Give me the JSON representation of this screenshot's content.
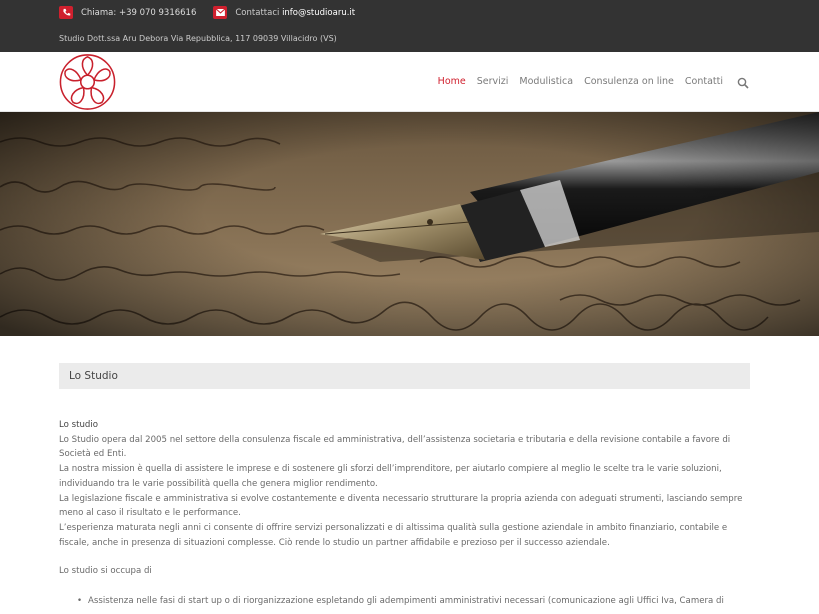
{
  "topbar": {
    "phone_label": "Chiama: +39 070 9316616",
    "email_prefix": "Contattaci",
    "email_value": "info@studioaru.it",
    "address": "Studio Dott.ssa Aru Debora Via Repubblica, 117 09039 Villacidro (VS)",
    "phone_icon": "phone-icon",
    "email_icon": "envelope-icon",
    "icon_bg_color": "#d0202e"
  },
  "nav": {
    "items": [
      {
        "label": "Home",
        "active": true
      },
      {
        "label": "Servizi",
        "active": false
      },
      {
        "label": "Modulistica",
        "active": false
      },
      {
        "label": "Consulenza on line",
        "active": false
      },
      {
        "label": "Contatti",
        "active": false
      }
    ],
    "search_icon": "search-icon",
    "accent_color": "#d0202e"
  },
  "hero": {
    "image_alt": "fountain-pen-on-handwritten-letter"
  },
  "section": {
    "title": "Lo Studio"
  },
  "content": {
    "subtitle": "Lo studio",
    "paragraphs": [
      "Lo Studio opera dal 2005 nel settore della consulenza fiscale ed amministrativa, dell’assistenza societaria e tributaria e della revisione contabile a favore di Società ed Enti.",
      "La nostra mission è quella di assistere le imprese e di sostenere gli sforzi dell’imprenditore, per aiutarlo compiere al meglio le scelte tra le varie soluzioni, individuando tra le varie possibilità quella che genera miglior rendimento.",
      "La legislazione fiscale e amministrativa si evolve costantemente e diventa necessario strutturare la propria azienda con adeguati strumenti, lasciando sempre meno al caso il risultato e le performance.",
      "L’esperienza maturata negli anni ci consente di offrire servizi personalizzati e di altissima qualità sulla gestione aziendale in ambito finanziario, contabile e fiscale, anche in presenza di situazioni complesse. Ciò rende lo studio un partner affidabile e prezioso per il successo aziendale."
    ],
    "occupa_label": "Lo studio si occupa di",
    "list": [
      "Assistenza nelle fasi di start up o di riorganizzazione espletando gli adempimenti amministrativi necessari (comunicazione agli Uffici Iva, Camera di"
    ]
  }
}
